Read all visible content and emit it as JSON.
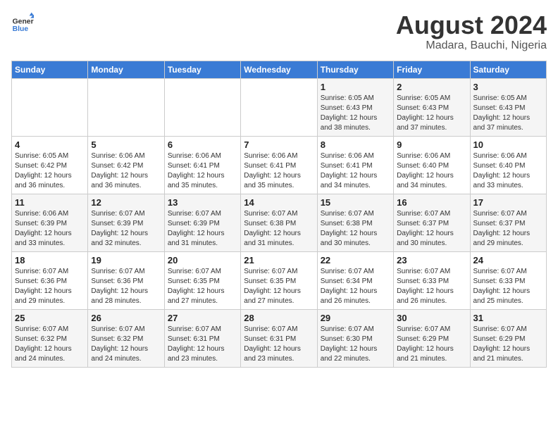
{
  "header": {
    "logo_line1": "General",
    "logo_line2": "Blue",
    "month_year": "August 2024",
    "location": "Madara, Bauchi, Nigeria"
  },
  "weekdays": [
    "Sunday",
    "Monday",
    "Tuesday",
    "Wednesday",
    "Thursday",
    "Friday",
    "Saturday"
  ],
  "weeks": [
    [
      {
        "day": "",
        "info": ""
      },
      {
        "day": "",
        "info": ""
      },
      {
        "day": "",
        "info": ""
      },
      {
        "day": "",
        "info": ""
      },
      {
        "day": "1",
        "info": "Sunrise: 6:05 AM\nSunset: 6:43 PM\nDaylight: 12 hours\nand 38 minutes."
      },
      {
        "day": "2",
        "info": "Sunrise: 6:05 AM\nSunset: 6:43 PM\nDaylight: 12 hours\nand 37 minutes."
      },
      {
        "day": "3",
        "info": "Sunrise: 6:05 AM\nSunset: 6:43 PM\nDaylight: 12 hours\nand 37 minutes."
      }
    ],
    [
      {
        "day": "4",
        "info": "Sunrise: 6:05 AM\nSunset: 6:42 PM\nDaylight: 12 hours\nand 36 minutes."
      },
      {
        "day": "5",
        "info": "Sunrise: 6:06 AM\nSunset: 6:42 PM\nDaylight: 12 hours\nand 36 minutes."
      },
      {
        "day": "6",
        "info": "Sunrise: 6:06 AM\nSunset: 6:41 PM\nDaylight: 12 hours\nand 35 minutes."
      },
      {
        "day": "7",
        "info": "Sunrise: 6:06 AM\nSunset: 6:41 PM\nDaylight: 12 hours\nand 35 minutes."
      },
      {
        "day": "8",
        "info": "Sunrise: 6:06 AM\nSunset: 6:41 PM\nDaylight: 12 hours\nand 34 minutes."
      },
      {
        "day": "9",
        "info": "Sunrise: 6:06 AM\nSunset: 6:40 PM\nDaylight: 12 hours\nand 34 minutes."
      },
      {
        "day": "10",
        "info": "Sunrise: 6:06 AM\nSunset: 6:40 PM\nDaylight: 12 hours\nand 33 minutes."
      }
    ],
    [
      {
        "day": "11",
        "info": "Sunrise: 6:06 AM\nSunset: 6:39 PM\nDaylight: 12 hours\nand 33 minutes."
      },
      {
        "day": "12",
        "info": "Sunrise: 6:07 AM\nSunset: 6:39 PM\nDaylight: 12 hours\nand 32 minutes."
      },
      {
        "day": "13",
        "info": "Sunrise: 6:07 AM\nSunset: 6:39 PM\nDaylight: 12 hours\nand 31 minutes."
      },
      {
        "day": "14",
        "info": "Sunrise: 6:07 AM\nSunset: 6:38 PM\nDaylight: 12 hours\nand 31 minutes."
      },
      {
        "day": "15",
        "info": "Sunrise: 6:07 AM\nSunset: 6:38 PM\nDaylight: 12 hours\nand 30 minutes."
      },
      {
        "day": "16",
        "info": "Sunrise: 6:07 AM\nSunset: 6:37 PM\nDaylight: 12 hours\nand 30 minutes."
      },
      {
        "day": "17",
        "info": "Sunrise: 6:07 AM\nSunset: 6:37 PM\nDaylight: 12 hours\nand 29 minutes."
      }
    ],
    [
      {
        "day": "18",
        "info": "Sunrise: 6:07 AM\nSunset: 6:36 PM\nDaylight: 12 hours\nand 29 minutes."
      },
      {
        "day": "19",
        "info": "Sunrise: 6:07 AM\nSunset: 6:36 PM\nDaylight: 12 hours\nand 28 minutes."
      },
      {
        "day": "20",
        "info": "Sunrise: 6:07 AM\nSunset: 6:35 PM\nDaylight: 12 hours\nand 27 minutes."
      },
      {
        "day": "21",
        "info": "Sunrise: 6:07 AM\nSunset: 6:35 PM\nDaylight: 12 hours\nand 27 minutes."
      },
      {
        "day": "22",
        "info": "Sunrise: 6:07 AM\nSunset: 6:34 PM\nDaylight: 12 hours\nand 26 minutes."
      },
      {
        "day": "23",
        "info": "Sunrise: 6:07 AM\nSunset: 6:33 PM\nDaylight: 12 hours\nand 26 minutes."
      },
      {
        "day": "24",
        "info": "Sunrise: 6:07 AM\nSunset: 6:33 PM\nDaylight: 12 hours\nand 25 minutes."
      }
    ],
    [
      {
        "day": "25",
        "info": "Sunrise: 6:07 AM\nSunset: 6:32 PM\nDaylight: 12 hours\nand 24 minutes."
      },
      {
        "day": "26",
        "info": "Sunrise: 6:07 AM\nSunset: 6:32 PM\nDaylight: 12 hours\nand 24 minutes."
      },
      {
        "day": "27",
        "info": "Sunrise: 6:07 AM\nSunset: 6:31 PM\nDaylight: 12 hours\nand 23 minutes."
      },
      {
        "day": "28",
        "info": "Sunrise: 6:07 AM\nSunset: 6:31 PM\nDaylight: 12 hours\nand 23 minutes."
      },
      {
        "day": "29",
        "info": "Sunrise: 6:07 AM\nSunset: 6:30 PM\nDaylight: 12 hours\nand 22 minutes."
      },
      {
        "day": "30",
        "info": "Sunrise: 6:07 AM\nSunset: 6:29 PM\nDaylight: 12 hours\nand 21 minutes."
      },
      {
        "day": "31",
        "info": "Sunrise: 6:07 AM\nSunset: 6:29 PM\nDaylight: 12 hours\nand 21 minutes."
      }
    ]
  ]
}
